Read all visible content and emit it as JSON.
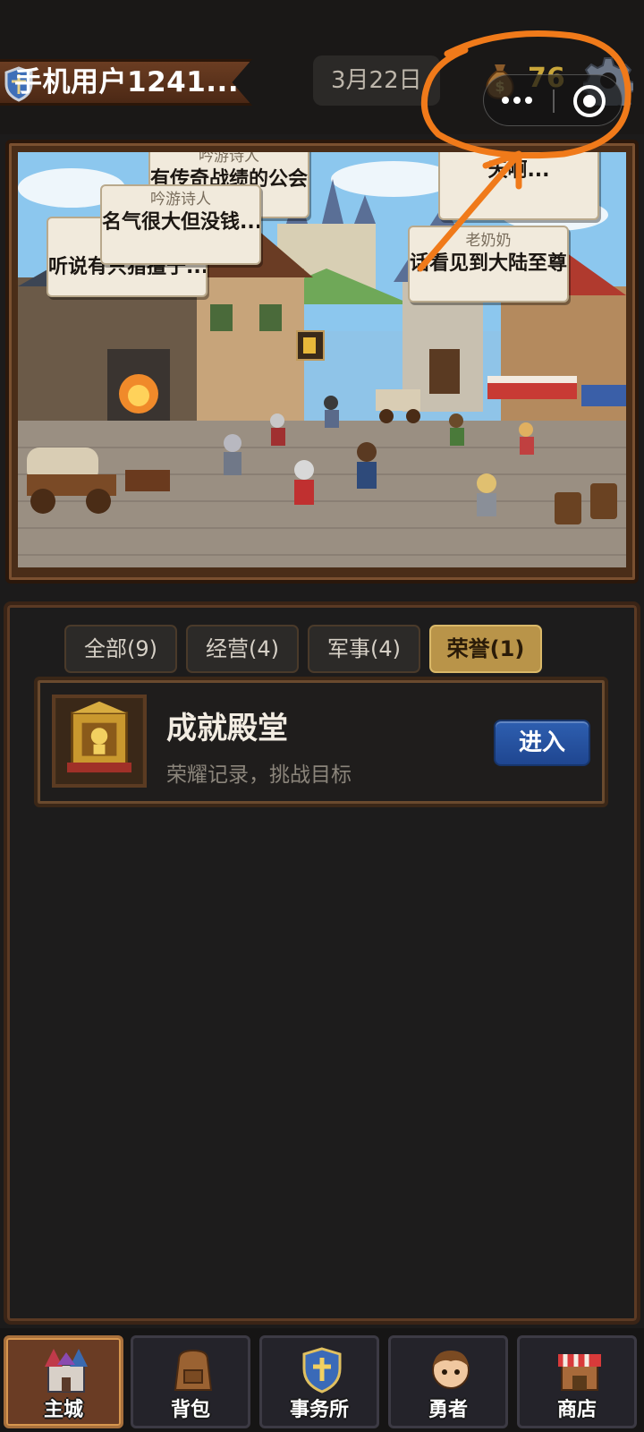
{
  "header": {
    "username": "手机用户1241...",
    "date": "3月22日",
    "gold": "76"
  },
  "scene": {
    "bubbles": [
      {
        "speaker": "吟游诗人",
        "text": "有传奇战绩的公会"
      },
      {
        "speaker": "吟游诗人",
        "text": "名气很大但没钱..."
      },
      {
        "speaker": "",
        "text": "听说有只猎擅于..."
      },
      {
        "speaker": "",
        "text": "天啊..."
      },
      {
        "speaker": "老奶奶",
        "text": "话看见到大陆至尊"
      }
    ]
  },
  "tabs": [
    {
      "label": "全部(9)",
      "active": false
    },
    {
      "label": "经营(4)",
      "active": false
    },
    {
      "label": "军事(4)",
      "active": false
    },
    {
      "label": "荣誉(1)",
      "active": true
    }
  ],
  "card": {
    "title": "成就殿堂",
    "description": "荣耀记录，挑战目标",
    "button_label": "进入"
  },
  "nav": [
    {
      "label": "主城",
      "icon": "castle-icon",
      "active": true
    },
    {
      "label": "背包",
      "icon": "backpack-icon",
      "active": false
    },
    {
      "label": "事务所",
      "icon": "shield-cross-icon",
      "active": false
    },
    {
      "label": "勇者",
      "icon": "hero-icon",
      "active": false
    },
    {
      "label": "商店",
      "icon": "shop-icon",
      "active": false
    }
  ],
  "colors": {
    "gold": "#c9a63a",
    "active_tab": "#b99449",
    "enter_button": "#2e5fb0",
    "annotation": "#f07a1a"
  }
}
